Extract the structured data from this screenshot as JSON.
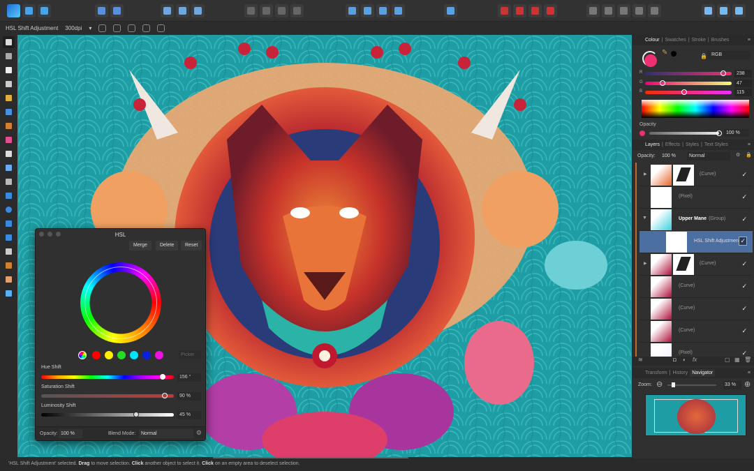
{
  "toolbar": {
    "groups": [
      {
        "icons": [
          "affinity-logo-icon",
          "pixel-persona-icon",
          "export-persona-icon"
        ]
      },
      {
        "icons": [
          "assistant-icon",
          "snapping-options-icon"
        ]
      },
      {
        "icons": [
          "select-bounding-icon",
          "transform-origin-icon",
          "transform-icon"
        ]
      },
      {
        "icons": [
          "move-back-icon",
          "move-forward-icon",
          "arrange-back-icon",
          "arrange-front-icon"
        ]
      },
      {
        "icons": [
          "flip-horizontal-icon",
          "flip-vertical-icon",
          "rotate-left-icon",
          "rotate-right-icon"
        ]
      },
      {
        "icons": [
          "align-icon"
        ]
      },
      {
        "icons": [
          "grid-icon",
          "snap-icon",
          "snapping-magnet-icon",
          "dropdown-icon"
        ]
      },
      {
        "icons": [
          "boolean-add-icon",
          "boolean-subtract-icon",
          "boolean-intersect-icon",
          "boolean-xor-icon",
          "boolean-divide-icon"
        ]
      },
      {
        "icons": [
          "insert-behind-icon",
          "insert-top-icon",
          "insert-inside-icon"
        ]
      }
    ]
  },
  "context": {
    "title": "HSL Shift Adjustment",
    "dpi": "300dpi"
  },
  "tools": [
    "move-tool-icon",
    "artboard-tool-icon",
    "node-tool-icon",
    "corner-tool-icon",
    "pen-tool-icon",
    "pencil-tool-icon",
    "brush-tool-icon",
    "fill-tool-icon",
    "transparency-tool-icon",
    "place-image-tool-icon",
    "crop-tool-icon",
    "rectangle-tool-icon",
    "ellipse-tool-icon",
    "rounded-rect-tool-icon",
    "triangle-tool-icon",
    "text-tool-icon",
    "color-picker-tool-icon",
    "hand-tool-icon",
    "zoom-tool-icon"
  ],
  "colour_panel": {
    "tabs": [
      "Colour",
      "Swatches",
      "Stroke",
      "Brushes"
    ],
    "model": "RGB",
    "r": 238,
    "g": 47,
    "b": 115,
    "r_label": "R",
    "g_label": "G",
    "b_label": "B",
    "opacity_label": "Opacity",
    "opacity": "100 %",
    "fill_color": "#ee2f73"
  },
  "layers_panel": {
    "tabs": [
      "Layers",
      "Effects",
      "Styles",
      "Text Styles"
    ],
    "opacity_label": "Opacity:",
    "opacity": "100 %",
    "blend": "Normal",
    "layers": [
      {
        "name": "(Curve)",
        "checked": true
      },
      {
        "name": "(Pixel)",
        "checked": true
      },
      {
        "name": "Upper Mane",
        "type": "(Group)",
        "checked": true
      },
      {
        "name": "HSL Shift Adjustment",
        "checked": true,
        "selected": true
      },
      {
        "name": "(Curve)",
        "checked": true
      },
      {
        "name": "(Curve)",
        "checked": true
      },
      {
        "name": "(Curve)",
        "checked": true
      },
      {
        "name": "(Curve)",
        "checked": true
      },
      {
        "name": "(Pixel)",
        "checked": true
      }
    ]
  },
  "navigator_panel": {
    "tabs": [
      "Transform",
      "History",
      "Navigator"
    ],
    "zoom_label": "Zoom:",
    "zoom": "33 %"
  },
  "hsl": {
    "title": "HSL",
    "merge": "Merge",
    "delete": "Delete",
    "reset": "Reset",
    "picker": "Picker",
    "hue_label": "Hue Shift",
    "hue": "156 °",
    "hue_value": 156,
    "sat_label": "Saturation Shift",
    "sat": "90 %",
    "sat_value": 90,
    "lum_label": "Luminosity Shift",
    "lum": "45 %",
    "lum_value": 45,
    "opacity_label": "Opacity:",
    "opacity": "100 %",
    "blend_label": "Blend Mode:",
    "blend": "Normal",
    "swatches": [
      "#ff0000",
      "#ffee00",
      "#22dd22",
      "#00e5ff",
      "#0a1fe0",
      "#ee10e0"
    ]
  },
  "status": {
    "pre": "'HSL Shift Adjustment' selected. ",
    "drag": "Drag",
    "t1": " to move selection. ",
    "click1": "Click",
    "t2": " another object to select it. ",
    "click2": "Click",
    "t3": " on an empty area to deselect selection."
  }
}
